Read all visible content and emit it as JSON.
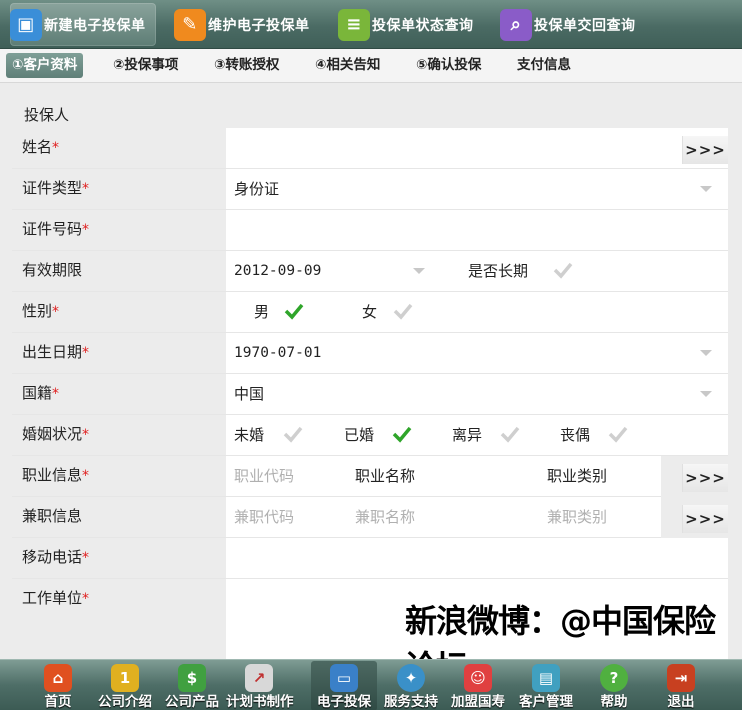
{
  "top_tabs": [
    {
      "label": "新建电子投保单",
      "icon": "person-card-icon",
      "color": "#3a8ed8"
    },
    {
      "label": "维护电子投保单",
      "icon": "edit-document-icon",
      "color": "#f08a1e"
    },
    {
      "label": "投保单状态查询",
      "icon": "document-status-icon",
      "color": "#7ab63a"
    },
    {
      "label": "投保单交回查询",
      "icon": "search-document-icon",
      "color": "#8a5cc8"
    }
  ],
  "steps": [
    "①客户资料",
    "②投保事项",
    "③转账授权",
    "④相关告知",
    "⑤确认投保",
    "支付信息"
  ],
  "section_title": "投保人",
  "required_mark": "*",
  "more_label": ">>>",
  "fields": {
    "name": {
      "label": "姓名",
      "value": ""
    },
    "id_type": {
      "label": "证件类型",
      "value": "身份证"
    },
    "id_number": {
      "label": "证件号码",
      "value": ""
    },
    "valid_period": {
      "label": "有效期限",
      "value": "2012-09-09",
      "long_term_label": "是否长期"
    },
    "gender": {
      "label": "性别",
      "options": [
        "男",
        "女"
      ],
      "selected": "男"
    },
    "birth_date": {
      "label": "出生日期",
      "value": "1970-07-01"
    },
    "nationality": {
      "label": "国籍",
      "value": "中国"
    },
    "marital_status": {
      "label": "婚姻状况",
      "options": [
        "未婚",
        "已婚",
        "离异",
        "丧偶"
      ],
      "selected": "已婚"
    },
    "occupation": {
      "label": "职业信息",
      "code_placeholder": "职业代码",
      "name": "职业名称",
      "category": "职业类别"
    },
    "part_time": {
      "label": "兼职信息",
      "code_placeholder": "兼职代码",
      "name_placeholder": "兼职名称",
      "category_placeholder": "兼职类别"
    },
    "mobile": {
      "label": "移动电话",
      "value": ""
    },
    "work_unit": {
      "label": "工作单位",
      "value": ""
    }
  },
  "watermark": "新浪微博：@中国保险论坛",
  "bottom_nav": [
    {
      "label": "首页",
      "icon": "home-icon",
      "color": "#e05020"
    },
    {
      "label": "公司介绍",
      "icon": "trophy-icon",
      "color": "#e0b020"
    },
    {
      "label": "公司产品",
      "icon": "money-bag-icon",
      "color": "#40a040"
    },
    {
      "label": "计划书制作",
      "icon": "chart-icon",
      "color": "#d8d8d8"
    },
    {
      "label": "电子投保",
      "icon": "laptop-icon",
      "color": "#3a80c8"
    },
    {
      "label": "服务支持",
      "icon": "compass-icon",
      "color": "#3a90c8"
    },
    {
      "label": "加盟国寿",
      "icon": "people-icon",
      "color": "#e04040"
    },
    {
      "label": "客户管理",
      "icon": "id-cards-icon",
      "color": "#40a0c0"
    },
    {
      "label": "帮助",
      "icon": "help-icon",
      "color": "#50b040"
    },
    {
      "label": "退出",
      "icon": "exit-door-icon",
      "color": "#c84020"
    }
  ],
  "colors": {
    "check_active": "#2fa52a",
    "check_inactive": "#cfcfcf",
    "required": "#e02020"
  }
}
